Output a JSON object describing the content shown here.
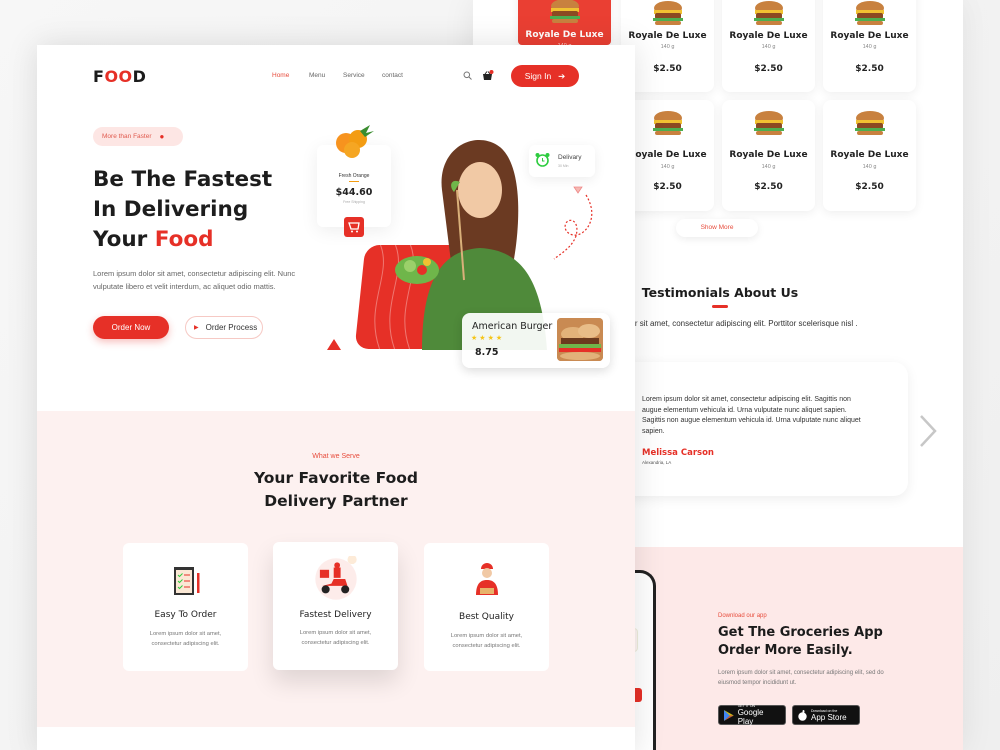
{
  "colors": {
    "accent": "#e63027",
    "pink_bg": "#fdf1f0",
    "app_bg": "#fde9e8"
  },
  "back_page": {
    "products": [
      {
        "name": "Royale De Luxe",
        "weight": "140 g",
        "price": "",
        "active": true
      },
      {
        "name": "Royale De Luxe",
        "weight": "140 g",
        "price": "$2.50"
      },
      {
        "name": "Royale De Luxe",
        "weight": "140 g",
        "price": "$2.50"
      },
      {
        "name": "Royale De Luxe",
        "weight": "140 g",
        "price": "$2.50"
      },
      {
        "name": "Royale De Luxe",
        "weight": "140 g",
        "price": "$2.50"
      },
      {
        "name": "Royale De Luxe",
        "weight": "140 g",
        "price": "$2.50"
      },
      {
        "name": "Royale De Luxe",
        "weight": "140 g",
        "price": "$2.50"
      }
    ],
    "show_more": "Show More",
    "testimonials": {
      "title": "Testimonials About Us",
      "subtitle": "sum dolor sit amet, consectetur adipiscing elit. Porttitor scelerisque nisl .",
      "quote": "Lorem ipsum dolor sit amet, consectetur adipiscing elit. Sagittis non augue elementum vehicula id. Urna vulputate nunc aliquet sapien. Sagittis non augue elementum vehicula id. Urna vulputate nunc aliquet sapien.",
      "name": "Melissa Carson",
      "location": "Alexandria, LA",
      "next_icon": "chevron-right-icon"
    },
    "app": {
      "label": "Download our app",
      "title_line1": "Get The Groceries App",
      "title_line2": "Order More Easily.",
      "text": "Lorem ipsum dolor sit amet, consectetur adipiscing elit, sed do eiusmod tempor incididunt ut.",
      "google_small": "GET IT ON",
      "google_big": "Google Play",
      "apple_small": "Download on the",
      "apple_big": "App Store"
    }
  },
  "front_page": {
    "logo": {
      "f": "F",
      "oo": "OO",
      "d": "D"
    },
    "nav": [
      "Home",
      "Menu",
      "Service",
      "contact"
    ],
    "nav_active": "Home",
    "signin": "Sign In",
    "hero": {
      "pill": "More than Faster",
      "title_line1": "Be The Fastest",
      "title_line2": "In Delivering",
      "title_line3_a": "Your ",
      "title_line3_b": "Food",
      "text": "Lorem ipsum dolor sit amet, consectetur adipiscing elit. Nunc vulputate libero et velit interdum, ac aliquet odio mattis.",
      "order_now": "Order Now",
      "order_process": "Order Process"
    },
    "orange_card": {
      "name": "Fresh Orange",
      "price": "$44.60",
      "shipping": "Free Shipping"
    },
    "delivery_card": {
      "title": "Delivary",
      "time": "30 Min"
    },
    "burger_card": {
      "name": "American Burger",
      "rating": 4,
      "price": "8.75"
    },
    "serve": {
      "label": "What we Serve",
      "title_line1": "Your Favorite Food",
      "title_line2": "Delivery Partner",
      "features": [
        {
          "title": "Easy To Order",
          "desc": "Lorem ipsum dolor sit amet, consectetur adipiscing elit."
        },
        {
          "title": "Fastest Delivery",
          "desc": "Lorem ipsum dolor sit amet, consectetur adipiscing elit."
        },
        {
          "title": "Best Quality",
          "desc": "Lorem ipsum dolor sit amet, consectetur adipiscing elit."
        }
      ]
    }
  }
}
